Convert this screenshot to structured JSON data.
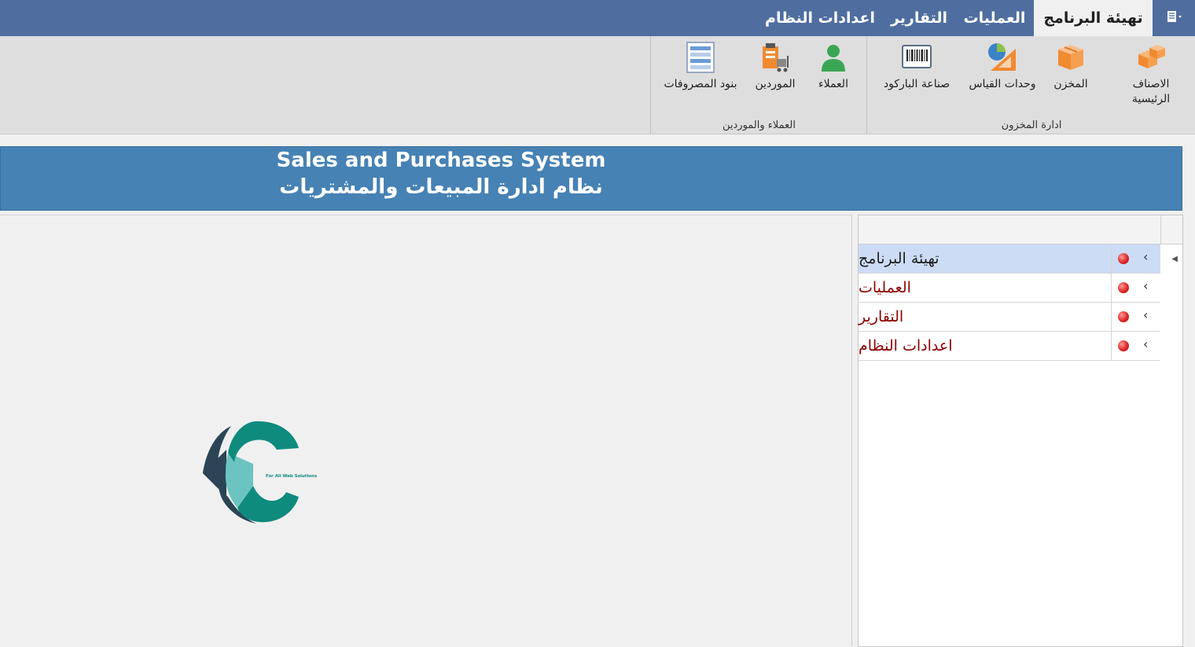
{
  "tabs": [
    {
      "label": "تهيئة البرنامج",
      "active": true
    },
    {
      "label": "العمليات",
      "active": false
    },
    {
      "label": "التقارير",
      "active": false
    },
    {
      "label": "اعدادات النظام",
      "active": false
    }
  ],
  "ribbon": {
    "groups": [
      {
        "label": "ادارة المخزون",
        "buttons": [
          {
            "label": "الاصناف الرئيسية",
            "icon": "boxes-icon"
          },
          {
            "label": "المخزن",
            "icon": "box-icon"
          },
          {
            "label": "وحدات القياس",
            "icon": "measure-icon"
          },
          {
            "label": "صناعة الباركود",
            "icon": "barcode-icon"
          }
        ]
      },
      {
        "label": "العملاء والموردين",
        "buttons": [
          {
            "label": "العملاء",
            "icon": "customer-icon"
          },
          {
            "label": "الموردين",
            "icon": "supplier-icon"
          },
          {
            "label": "بنود المصروفات",
            "icon": "expenses-icon"
          }
        ]
      }
    ]
  },
  "banner": {
    "title_en": "Sales and Purchases System",
    "title_ar": "نظام ادارة المبيعات والمشتريات"
  },
  "logo": {
    "tagline": "For All Web Solutions",
    "colors": {
      "teal": "#0f8b7e",
      "light_teal": "#6cc4c0",
      "navy": "#2b4556"
    }
  },
  "nav": {
    "items": [
      {
        "label": "تهيئة البرنامج",
        "selected": true
      },
      {
        "label": "العمليات",
        "selected": false
      },
      {
        "label": "التقارير",
        "selected": false
      },
      {
        "label": "اعدادات النظام",
        "selected": false
      }
    ]
  },
  "colors": {
    "tabbar": "#4f6e9f",
    "banner": "#4682b4",
    "nav_text": "#8b0000",
    "selected_row": "#cddcf5"
  }
}
